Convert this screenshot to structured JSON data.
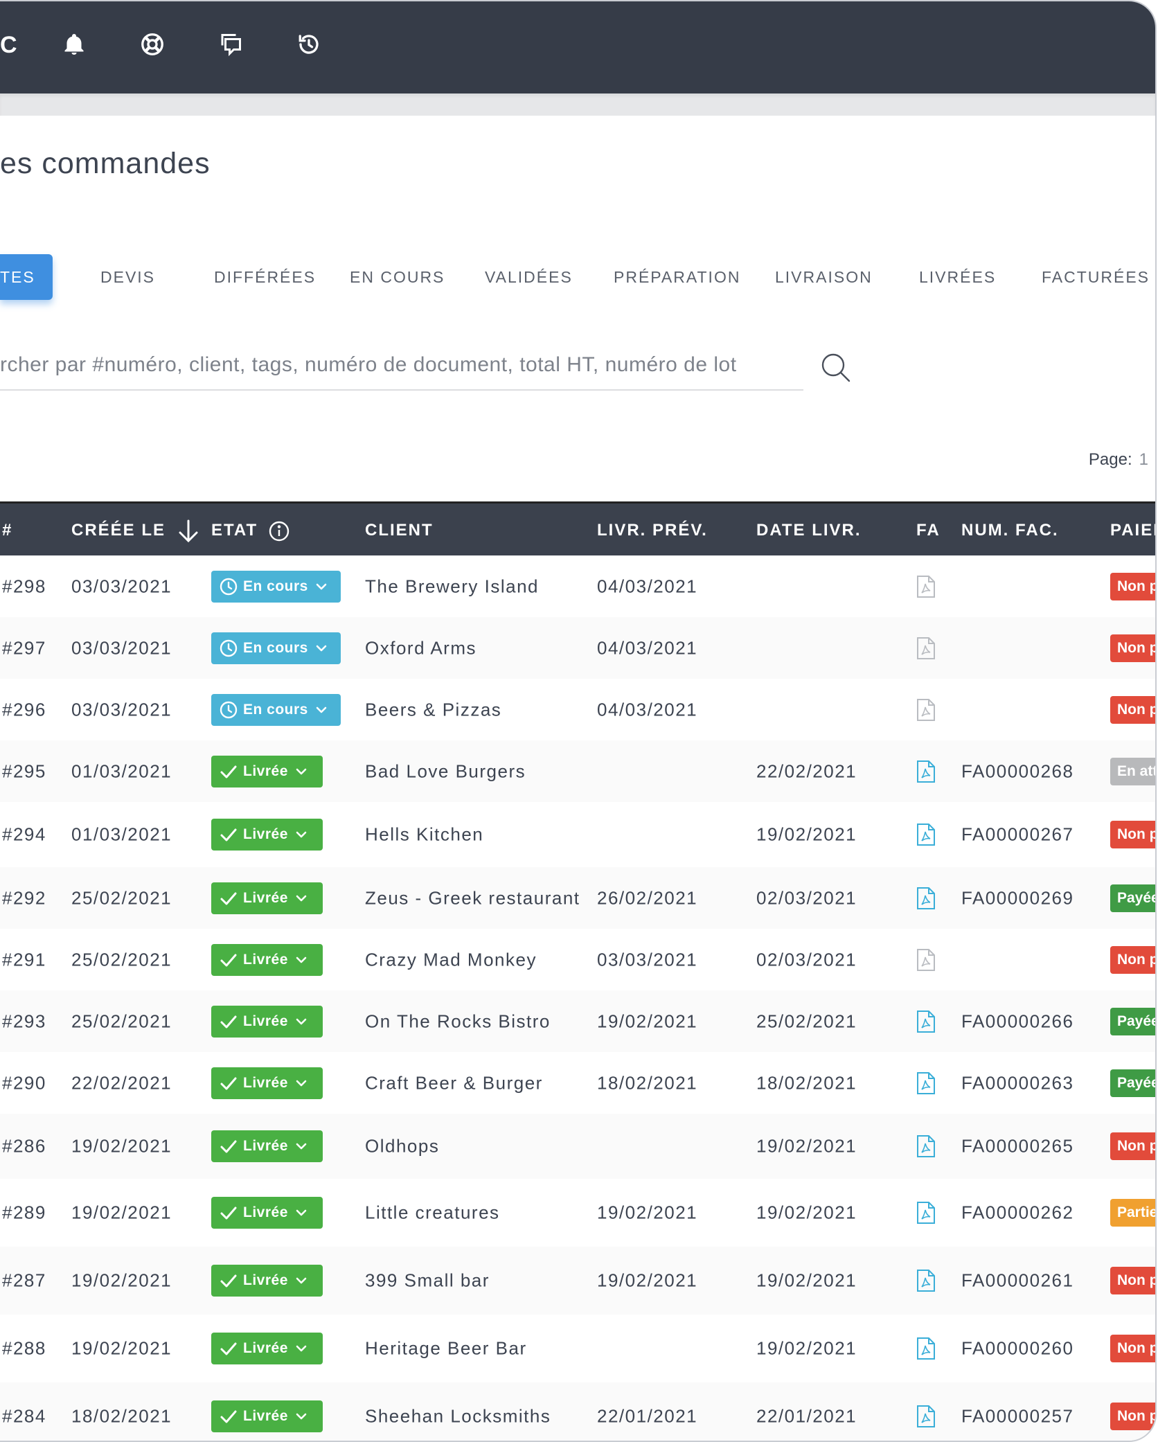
{
  "topbar": {
    "sliver_text": "C",
    "icons": [
      "bell-icon",
      "lifebuoy-icon",
      "chat-icon",
      "history-icon"
    ]
  },
  "page": {
    "title": "es commandes"
  },
  "tabs": [
    {
      "label": "TES",
      "active": true
    },
    {
      "label": "DEVIS"
    },
    {
      "label": "DIFFÉRÉES"
    },
    {
      "label": "EN COURS"
    },
    {
      "label": "VALIDÉES"
    },
    {
      "label": "PRÉPARATION"
    },
    {
      "label": "LIVRAISON"
    },
    {
      "label": "LIVRÉES"
    },
    {
      "label": "FACTURÉES"
    }
  ],
  "search": {
    "placeholder": "rcher par #numéro, client, tags, numéro de document, total HT, numéro de lot",
    "value": ""
  },
  "pager": {
    "label": "Page:",
    "current": "1"
  },
  "table": {
    "headers": {
      "id": "#",
      "created": "CRÉÉE LE",
      "state": "ETAT",
      "client": "CLIENT",
      "livr_prev": "LIVR. PRÉV.",
      "date_livr": "DATE LIVR.",
      "fa": "FA",
      "num_fac": "NUM. FAC.",
      "payment": "PAIEM"
    },
    "colors": {
      "en_cours": "#4ab3d6",
      "livree": "#49b043",
      "non_paye": "#e24b3b",
      "en_attente": "#b8b9bb",
      "payee": "#3f9b45",
      "partiel": "#f0a030"
    },
    "rows": [
      {
        "id": "#298",
        "created": "03/03/2021",
        "state": "En cours",
        "client": "The Brewery Island",
        "livr_prev": "04/03/2021",
        "date_livr": "",
        "fa": "inactive",
        "num_fac": "",
        "payment": "Non p",
        "pay_status": "non_paye"
      },
      {
        "id": "#297",
        "created": "03/03/2021",
        "state": "En cours",
        "client": "Oxford Arms",
        "livr_prev": "04/03/2021",
        "date_livr": "",
        "fa": "inactive",
        "num_fac": "",
        "payment": "Non p",
        "pay_status": "non_paye"
      },
      {
        "id": "#296",
        "created": "03/03/2021",
        "state": "En cours",
        "client": "Beers & Pizzas",
        "livr_prev": "04/03/2021",
        "date_livr": "",
        "fa": "inactive",
        "num_fac": "",
        "payment": "Non p",
        "pay_status": "non_paye"
      },
      {
        "id": "#295",
        "created": "01/03/2021",
        "state": "Livrée",
        "client": "Bad Love Burgers",
        "livr_prev": "",
        "date_livr": "22/02/2021",
        "fa": "active",
        "num_fac": "FA00000268",
        "payment": "En att",
        "pay_status": "en_attente"
      },
      {
        "id": "#294",
        "created": "01/03/2021",
        "state": "Livrée",
        "client": "Hells Kitchen",
        "livr_prev": "",
        "date_livr": "19/02/2021",
        "fa": "active",
        "num_fac": "FA00000267",
        "payment": "Non p",
        "pay_status": "non_paye"
      },
      {
        "id": "#292",
        "created": "25/02/2021",
        "state": "Livrée",
        "client": "Zeus - Greek restaurant",
        "livr_prev": "26/02/2021",
        "date_livr": "02/03/2021",
        "fa": "active",
        "num_fac": "FA00000269",
        "payment": "Payée",
        "pay_status": "payee"
      },
      {
        "id": "#291",
        "created": "25/02/2021",
        "state": "Livrée",
        "client": "Crazy Mad Monkey",
        "livr_prev": "03/03/2021",
        "date_livr": "02/03/2021",
        "fa": "inactive",
        "num_fac": "",
        "payment": "Non p",
        "pay_status": "non_paye"
      },
      {
        "id": "#293",
        "created": "25/02/2021",
        "state": "Livrée",
        "client": "On The Rocks Bistro",
        "livr_prev": "19/02/2021",
        "date_livr": "25/02/2021",
        "fa": "active",
        "num_fac": "FA00000266",
        "payment": "Payée",
        "pay_status": "payee"
      },
      {
        "id": "#290",
        "created": "22/02/2021",
        "state": "Livrée",
        "client": "Craft Beer & Burger",
        "livr_prev": "18/02/2021",
        "date_livr": "18/02/2021",
        "fa": "active",
        "num_fac": "FA00000263",
        "payment": "Payée",
        "pay_status": "payee"
      },
      {
        "id": "#286",
        "created": "19/02/2021",
        "state": "Livrée",
        "client": "Oldhops",
        "livr_prev": "",
        "date_livr": "19/02/2021",
        "fa": "active",
        "num_fac": "FA00000265",
        "payment": "Non p",
        "pay_status": "non_paye"
      },
      {
        "id": "#289",
        "created": "19/02/2021",
        "state": "Livrée",
        "client": "Little creatures",
        "livr_prev": "19/02/2021",
        "date_livr": "19/02/2021",
        "fa": "active",
        "num_fac": "FA00000262",
        "payment": "Partie",
        "pay_status": "partiel"
      },
      {
        "id": "#287",
        "created": "19/02/2021",
        "state": "Livrée",
        "client": "399 Small bar",
        "livr_prev": "19/02/2021",
        "date_livr": "19/02/2021",
        "fa": "active",
        "num_fac": "FA00000261",
        "payment": "Non p",
        "pay_status": "non_paye"
      },
      {
        "id": "#288",
        "created": "19/02/2021",
        "state": "Livrée",
        "client": "Heritage Beer Bar",
        "livr_prev": "",
        "date_livr": "19/02/2021",
        "fa": "active",
        "num_fac": "FA00000260",
        "payment": "Non p",
        "pay_status": "non_paye"
      },
      {
        "id": "#284",
        "created": "18/02/2021",
        "state": "Livrée",
        "client": "Sheehan Locksmiths",
        "livr_prev": "22/01/2021",
        "date_livr": "22/01/2021",
        "fa": "active",
        "num_fac": "FA00000257",
        "payment": "Non p",
        "pay_status": "non_paye"
      }
    ]
  }
}
